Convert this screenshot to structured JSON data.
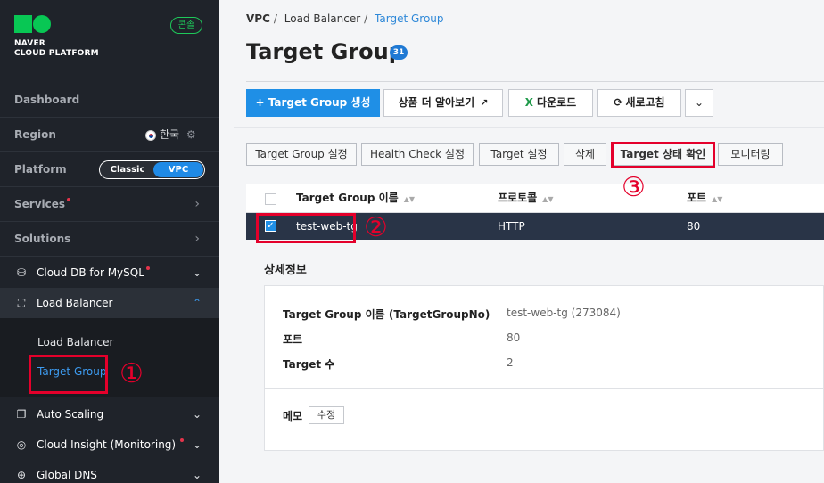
{
  "sidebar": {
    "logo_line1": "NAVER",
    "logo_line2": "CLOUD PLATFORM",
    "console_badge": "콘솔",
    "dashboard": "Dashboard",
    "region_label": "Region",
    "region_value": "한국",
    "platform_label": "Platform",
    "platform_options": [
      "Classic",
      "VPC"
    ],
    "platform_selected": "VPC",
    "services": "Services",
    "solutions": "Solutions",
    "menu": [
      {
        "label": "Cloud DB for MySQL",
        "icon": "database-icon",
        "new": true
      },
      {
        "label": "Load Balancer",
        "icon": "load-balancer-icon",
        "new": false,
        "expanded": true
      },
      {
        "label": "Auto Scaling",
        "icon": "auto-scaling-icon",
        "new": false
      },
      {
        "label": "Cloud Insight (Monitoring)",
        "icon": "monitoring-icon",
        "new": true
      },
      {
        "label": "Global DNS",
        "icon": "globe-icon",
        "new": false
      }
    ],
    "submenu": [
      "Load Balancer",
      "Target Group"
    ],
    "submenu_selected": "Target Group"
  },
  "annotations": [
    "①",
    "②",
    "③"
  ],
  "breadcrumb": [
    "VPC",
    "Load Balancer",
    "Target Group"
  ],
  "page_title": "Target Group",
  "count_badge": "31",
  "toolbar": {
    "create": "+ Target Group 생성",
    "learn_more": "상품 더 알아보기",
    "download": "다운로드",
    "refresh": "새로고침"
  },
  "actions": [
    "Target Group 설정",
    "Health Check 설정",
    "Target 설정",
    "삭제",
    "Target 상태 확인",
    "모니터링"
  ],
  "table": {
    "columns": [
      "Target Group 이름",
      "프로토콜",
      "포트"
    ],
    "rows": [
      {
        "name": "test-web-tg",
        "protocol": "HTTP",
        "port": "80",
        "checked": true
      }
    ]
  },
  "detail": {
    "title": "상세정보",
    "fields": [
      {
        "label": "Target Group 이름 (TargetGroupNo)",
        "value": "test-web-tg (273084)"
      },
      {
        "label": "포트",
        "value": "80"
      },
      {
        "label": "Target 수",
        "value": "2"
      }
    ],
    "memo_label": "메모",
    "memo_edit": "수정"
  },
  "colors": {
    "accent": "#1f8fe6",
    "sidebar_bg": "#1f232a",
    "selected_row": "#293447",
    "annotation": "#e4002b",
    "brand_green": "#08c754"
  }
}
